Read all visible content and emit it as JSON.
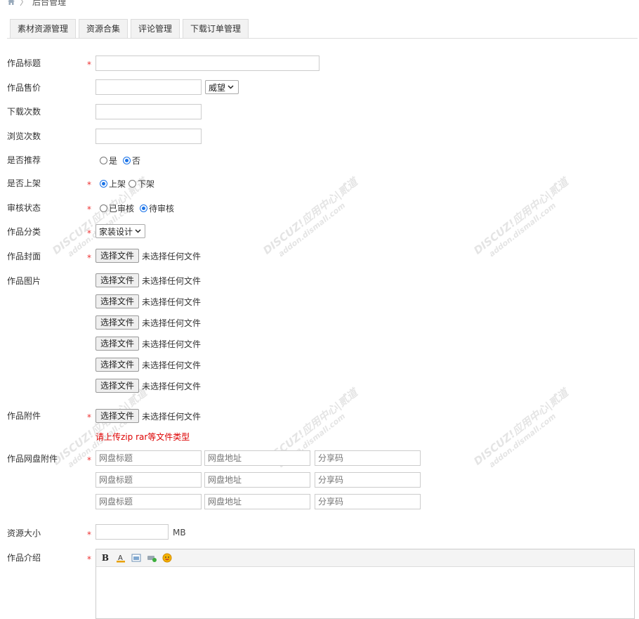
{
  "breadcrumb": {
    "home_icon": "home-icon",
    "current": "后台管理"
  },
  "tabs": [
    {
      "label": "素材资源管理"
    },
    {
      "label": "资源合集"
    },
    {
      "label": "评论管理"
    },
    {
      "label": "下载订单管理"
    }
  ],
  "form": {
    "required_mark": "*",
    "title": {
      "label": "作品标题",
      "value": ""
    },
    "price": {
      "label": "作品售价",
      "value": "",
      "currency": "威望"
    },
    "downloads": {
      "label": "下载次数",
      "value": ""
    },
    "views": {
      "label": "浏览次数",
      "value": ""
    },
    "recommend": {
      "label": "是否推荐",
      "options": [
        "是",
        "否"
      ],
      "selected": "否"
    },
    "listed": {
      "label": "是否上架",
      "options": [
        "上架",
        "下架"
      ],
      "selected": "上架"
    },
    "review": {
      "label": "审核状态",
      "options": [
        "已审核",
        "待审核"
      ],
      "selected": "待审核"
    },
    "category": {
      "label": "作品分类",
      "value": "家装设计"
    },
    "file_button": "选择文件",
    "file_none": "未选择任何文件",
    "cover": {
      "label": "作品封面"
    },
    "images": {
      "label": "作品图片",
      "count": 6
    },
    "attachment": {
      "label": "作品附件",
      "hint": "请上传zip rar等文件类型"
    },
    "netdisk": {
      "label": "作品网盘附件",
      "title_placeholder": "网盘标题",
      "url_placeholder": "网盘地址",
      "code_placeholder": "分享码",
      "rows": 3
    },
    "size": {
      "label": "资源大小",
      "value": "",
      "unit": "MB"
    },
    "intro": {
      "label": "作品介绍",
      "toolbar": [
        "bold-icon",
        "font-color-icon",
        "image-icon",
        "link-icon",
        "emoji-icon"
      ],
      "bold_glyph": "B",
      "color_glyph": "A"
    }
  },
  "watermark": {
    "line1": "DISCUZ!应用中心|贰道",
    "line2": "addon.dismall.com"
  }
}
